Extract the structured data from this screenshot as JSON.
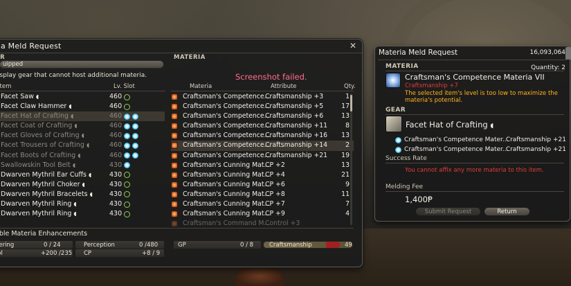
{
  "main_window": {
    "title": "a Meld Request",
    "close_icon": "close-icon",
    "gear_section_label": "AR",
    "materia_section_label": "MATERIA",
    "dropdown_value": "uipped",
    "checkbox_label": "isplay gear that cannot host additional materia.",
    "screenshot_failed": "Screenshot failed.",
    "gear_columns": {
      "item": "Item",
      "lv_slot": "Lv. Slot"
    },
    "materia_columns": {
      "materia": "Materia",
      "attribute": "Attribute",
      "qty": "Qty."
    },
    "gear": [
      {
        "name": "Facet Saw",
        "lv": "460",
        "filled": 0,
        "empty": 1,
        "dim": false,
        "selected": false
      },
      {
        "name": "Facet Claw Hammer",
        "lv": "460",
        "filled": 0,
        "empty": 1,
        "dim": false,
        "selected": false
      },
      {
        "name": "Facet Hat of Crafting",
        "lv": "460",
        "filled": 2,
        "empty": 0,
        "dim": true,
        "selected": true
      },
      {
        "name": "Facet Coat of Crafting",
        "lv": "460",
        "filled": 2,
        "empty": 0,
        "dim": true,
        "selected": false
      },
      {
        "name": "Facet Gloves of Crafting",
        "lv": "460",
        "filled": 2,
        "empty": 0,
        "dim": true,
        "selected": false
      },
      {
        "name": "Facet Trousers of Crafting",
        "lv": "460",
        "filled": 2,
        "empty": 0,
        "dim": true,
        "selected": false
      },
      {
        "name": "Facet Boots of Crafting",
        "lv": "460",
        "filled": 2,
        "empty": 0,
        "dim": true,
        "selected": false
      },
      {
        "name": "Swallowskin Tool Belt",
        "lv": "430",
        "filled": 1,
        "empty": 0,
        "dim": true,
        "selected": false
      },
      {
        "name": "Dwarven Mythril Ear Cuffs",
        "lv": "430",
        "filled": 0,
        "empty": 1,
        "dim": false,
        "selected": false
      },
      {
        "name": "Dwarven Mythril Choker",
        "lv": "430",
        "filled": 0,
        "empty": 1,
        "dim": false,
        "selected": false
      },
      {
        "name": "Dwarven Mythril Bracelets",
        "lv": "430",
        "filled": 0,
        "empty": 1,
        "dim": false,
        "selected": false
      },
      {
        "name": "Dwarven Mythril Ring",
        "lv": "430",
        "filled": 0,
        "empty": 1,
        "dim": false,
        "selected": false
      },
      {
        "name": "Dwarven Mythril Ring",
        "lv": "430",
        "filled": 0,
        "empty": 1,
        "dim": false,
        "selected": false
      }
    ],
    "materia": [
      {
        "name": "Craftsman's Competence...",
        "attr": "Craftsmanship +3",
        "qty": "1",
        "selected": false,
        "faded": false
      },
      {
        "name": "Craftsman's Competence...",
        "attr": "Craftsmanship +5",
        "qty": "17",
        "selected": false,
        "faded": false
      },
      {
        "name": "Craftsman's Competence...",
        "attr": "Craftsmanship +6",
        "qty": "13",
        "selected": false,
        "faded": false
      },
      {
        "name": "Craftsman's Competence...",
        "attr": "Craftsmanship +11",
        "qty": "8",
        "selected": false,
        "faded": false
      },
      {
        "name": "Craftsman's Competence...",
        "attr": "Craftsmanship +16",
        "qty": "13",
        "selected": false,
        "faded": false
      },
      {
        "name": "Craftsman's Competence...",
        "attr": "Craftsmanship +14",
        "qty": "2",
        "selected": true,
        "faded": false
      },
      {
        "name": "Craftsman's Competence...",
        "attr": "Craftsmanship +21",
        "qty": "19",
        "selected": false,
        "faded": false
      },
      {
        "name": "Craftsman's Cunning Mat...",
        "attr": "CP +2",
        "qty": "13",
        "selected": false,
        "faded": false
      },
      {
        "name": "Craftsman's Cunning Mat...",
        "attr": "CP +4",
        "qty": "21",
        "selected": false,
        "faded": false
      },
      {
        "name": "Craftsman's Cunning Mat...",
        "attr": "CP +6",
        "qty": "9",
        "selected": false,
        "faded": false
      },
      {
        "name": "Craftsman's Cunning Mat...",
        "attr": "CP +8",
        "qty": "11",
        "selected": false,
        "faded": false
      },
      {
        "name": "Craftsman's Cunning Mat...",
        "attr": "CP +7",
        "qty": "7",
        "selected": false,
        "faded": false
      },
      {
        "name": "Craftsman's Cunning Mat...",
        "attr": "CP +9",
        "qty": "4",
        "selected": false,
        "faded": false
      },
      {
        "name": "Craftsman's Command M...",
        "attr": "Control +3",
        "qty": "",
        "selected": false,
        "faded": true
      }
    ],
    "stats_title": "able Materia Enhancements",
    "stats": {
      "r1_label": "hering",
      "r1_value": "0 / 24",
      "r2_label": "rol",
      "r2_value": "+200 /235",
      "perception_label": "Perception",
      "perception_value": "0 /480",
      "cp_label": "CP",
      "cp_value": "+8 /  9",
      "gp_label": "GP",
      "gp_value": "0 /  8",
      "craftsmanship_label": "Craftsmanship",
      "craftsmanship_value": "49"
    }
  },
  "detail_panel": {
    "title": "Materia Meld Request",
    "gil": "16,093,064",
    "materia_label": "MATERIA",
    "quantity": "Quantity: 2",
    "materia_name": "Craftsman's Competence Materia VII",
    "materia_attr": "Craftsmanship +7",
    "warning": "The selected item's level is too low to maximize the materia's potential.",
    "gear_label": "GEAR",
    "gear_name": "Facet Hat of Crafting",
    "melds": [
      {
        "name": "Craftsman's Competence Mater...",
        "attr": "Craftsmanship +21"
      },
      {
        "name": "Craftsman's Competence Mater...",
        "attr": "Craftsmanship +21"
      }
    ],
    "success_rate_label": "Success Rate",
    "error": "You cannot affix any more materia to this item.",
    "fee_label": "Melding Fee",
    "fee": "1,400Ᵽ",
    "submit_label": "Submit Request",
    "return_label": "Return"
  }
}
